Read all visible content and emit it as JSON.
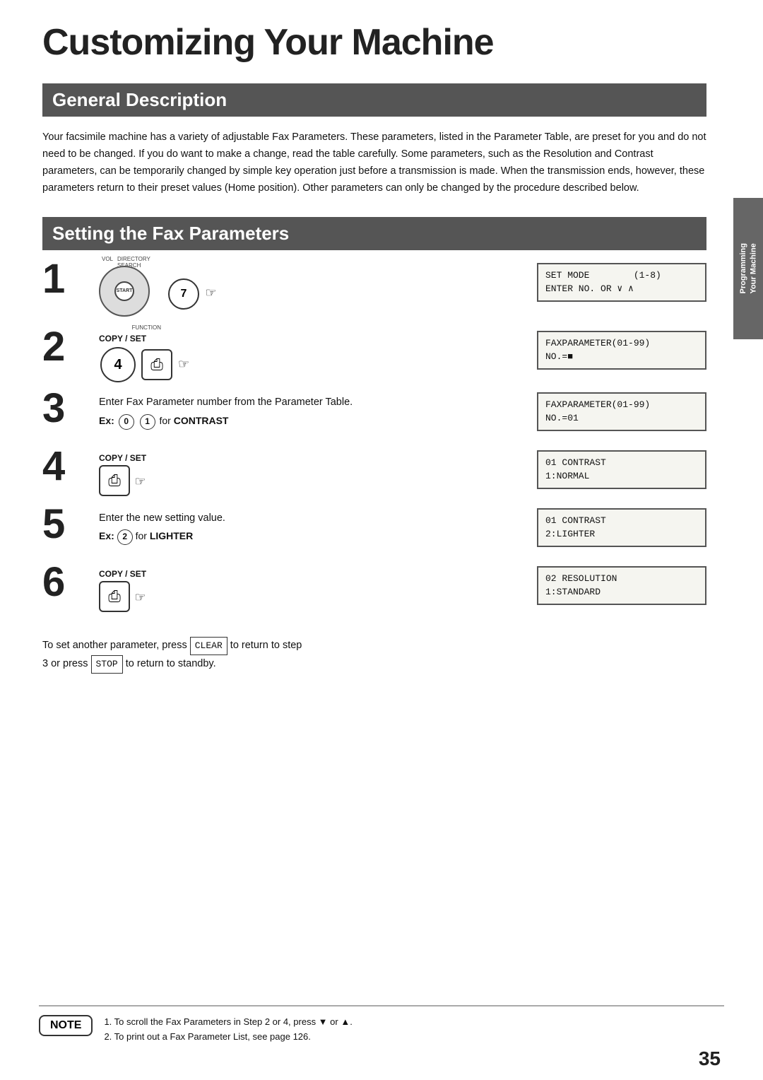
{
  "page": {
    "title": "Customizing Your Machine",
    "side_tab_line1": "Programming",
    "side_tab_line2": "Your Machine",
    "page_number": "35"
  },
  "sections": {
    "general": {
      "heading": "General Description",
      "body": "Your facsimile machine has a variety of adjustable Fax Parameters. These parameters, listed in the Parameter Table, are preset for you and do not need to be changed. If you do want to make a change, read the table carefully. Some parameters, such as the Resolution and Contrast parameters, can be temporarily changed by simple key operation just before a transmission is made. When the transmission ends, however, these parameters return to their preset values (Home position). Other parameters can only be changed by the procedure described below."
    },
    "setting": {
      "heading": "Setting the  Fax Parameters"
    }
  },
  "steps": [
    {
      "number": "1",
      "has_keys": true,
      "key_type": "dial_7",
      "lcd": [
        {
          "line1": "SET MODE        (1-8)",
          "line2": "ENTER NO. OR ∨ ∧"
        }
      ]
    },
    {
      "number": "2",
      "label": "COPY / SET",
      "key_type": "copy_set_4",
      "lcd": [
        {
          "line1": "FAXPARAMETER(01-99)",
          "line2": "NO.=■"
        }
      ]
    },
    {
      "number": "3",
      "text": "Enter Fax Parameter number from the Parameter Table.",
      "ex_text": "Ex: ⓪ ① for CONTRAST",
      "lcd": [
        {
          "line1": "FAXPARAMETER(01-99)",
          "line2": "NO.=01"
        }
      ]
    },
    {
      "number": "4",
      "label": "COPY / SET",
      "key_type": "copy_set_only",
      "lcd": [
        {
          "line1": "01 CONTRAST",
          "line2": "1:NORMAL"
        }
      ]
    },
    {
      "number": "5",
      "text": "Enter the new setting value.",
      "ex_text": "Ex: ② for LIGHTER",
      "lcd": [
        {
          "line1": "01 CONTRAST",
          "line2": "2:LIGHTER"
        }
      ]
    },
    {
      "number": "6",
      "label": "COPY / SET",
      "key_type": "copy_set_only",
      "lcd": [
        {
          "line1": "02 RESOLUTION",
          "line2": "1:STANDARD"
        }
      ]
    }
  ],
  "clear_stop_text": {
    "line1": "To set another parameter, press  CLEAR  to return to step",
    "line2": "3 or press  STOP  to return to standby."
  },
  "note": {
    "label": "NOTE",
    "items": [
      "1.  To scroll the Fax Parameters in Step 2 or 4, press ▼ or ▲.",
      "2.  To print out a Fax Parameter List, see page 126."
    ]
  }
}
